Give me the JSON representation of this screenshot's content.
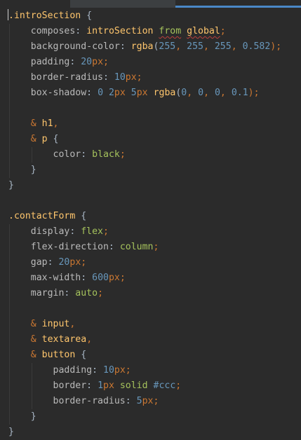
{
  "lines": [
    {
      "tokens": [
        {
          "t": ".",
          "c": "sel"
        },
        {
          "t": "introSection",
          "c": "sel"
        },
        {
          "t": " {",
          "c": "brace"
        }
      ]
    },
    {
      "tokens": [
        {
          "t": "    ",
          "c": ""
        },
        {
          "t": "composes",
          "c": "prop"
        },
        {
          "t": ": ",
          "c": "brace"
        },
        {
          "t": "introSection",
          "c": "fn"
        },
        {
          "t": " ",
          "c": ""
        },
        {
          "t": "from",
          "c": "val squig"
        },
        {
          "t": " ",
          "c": ""
        },
        {
          "t": "global",
          "c": "fn squig"
        },
        {
          "t": ";",
          "c": "punct"
        }
      ]
    },
    {
      "tokens": [
        {
          "t": "    ",
          "c": ""
        },
        {
          "t": "background-color",
          "c": "prop"
        },
        {
          "t": ": ",
          "c": "brace"
        },
        {
          "t": "rgba",
          "c": "fn"
        },
        {
          "t": "(",
          "c": "brace"
        },
        {
          "t": "255",
          "c": "num"
        },
        {
          "t": ", ",
          "c": "punct"
        },
        {
          "t": "255",
          "c": "num"
        },
        {
          "t": ", ",
          "c": "punct"
        },
        {
          "t": "255",
          "c": "num"
        },
        {
          "t": ", ",
          "c": "punct"
        },
        {
          "t": "0.582",
          "c": "num"
        },
        {
          "t": ");",
          "c": "punct"
        }
      ]
    },
    {
      "tokens": [
        {
          "t": "    ",
          "c": ""
        },
        {
          "t": "padding",
          "c": "prop"
        },
        {
          "t": ": ",
          "c": "brace"
        },
        {
          "t": "20",
          "c": "num"
        },
        {
          "t": "px",
          "c": "kw"
        },
        {
          "t": ";",
          "c": "punct"
        }
      ]
    },
    {
      "tokens": [
        {
          "t": "    ",
          "c": ""
        },
        {
          "t": "border-radius",
          "c": "prop"
        },
        {
          "t": ": ",
          "c": "brace"
        },
        {
          "t": "10",
          "c": "num"
        },
        {
          "t": "px",
          "c": "kw"
        },
        {
          "t": ";",
          "c": "punct"
        }
      ]
    },
    {
      "tokens": [
        {
          "t": "    ",
          "c": ""
        },
        {
          "t": "box-shadow",
          "c": "prop"
        },
        {
          "t": ": ",
          "c": "brace"
        },
        {
          "t": "0",
          "c": "num"
        },
        {
          "t": " ",
          "c": ""
        },
        {
          "t": "2",
          "c": "num"
        },
        {
          "t": "px",
          "c": "kw"
        },
        {
          "t": " ",
          "c": ""
        },
        {
          "t": "5",
          "c": "num"
        },
        {
          "t": "px",
          "c": "kw"
        },
        {
          "t": " ",
          "c": ""
        },
        {
          "t": "rgba",
          "c": "fn"
        },
        {
          "t": "(",
          "c": "brace"
        },
        {
          "t": "0",
          "c": "num"
        },
        {
          "t": ", ",
          "c": "punct"
        },
        {
          "t": "0",
          "c": "num"
        },
        {
          "t": ", ",
          "c": "punct"
        },
        {
          "t": "0",
          "c": "num"
        },
        {
          "t": ", ",
          "c": "punct"
        },
        {
          "t": "0.1",
          "c": "num"
        },
        {
          "t": ");",
          "c": "punct"
        }
      ]
    },
    {
      "tokens": []
    },
    {
      "tokens": [
        {
          "t": "    ",
          "c": ""
        },
        {
          "t": "& ",
          "c": "kw"
        },
        {
          "t": "h1",
          "c": "sel"
        },
        {
          "t": ",",
          "c": "punct"
        }
      ]
    },
    {
      "tokens": [
        {
          "t": "    ",
          "c": ""
        },
        {
          "t": "& ",
          "c": "kw"
        },
        {
          "t": "p",
          "c": "sel"
        },
        {
          "t": " {",
          "c": "brace"
        }
      ]
    },
    {
      "tokens": [
        {
          "t": "        ",
          "c": ""
        },
        {
          "t": "color",
          "c": "prop"
        },
        {
          "t": ": ",
          "c": "brace"
        },
        {
          "t": "black",
          "c": "val"
        },
        {
          "t": ";",
          "c": "punct"
        }
      ]
    },
    {
      "tokens": [
        {
          "t": "    ",
          "c": ""
        },
        {
          "t": "}",
          "c": "brace"
        }
      ]
    },
    {
      "tokens": [
        {
          "t": "}",
          "c": "brace"
        }
      ]
    },
    {
      "tokens": []
    },
    {
      "tokens": [
        {
          "t": ".",
          "c": "sel"
        },
        {
          "t": "contactForm",
          "c": "sel"
        },
        {
          "t": " {",
          "c": "brace"
        }
      ]
    },
    {
      "tokens": [
        {
          "t": "    ",
          "c": ""
        },
        {
          "t": "display",
          "c": "prop"
        },
        {
          "t": ": ",
          "c": "brace"
        },
        {
          "t": "flex",
          "c": "val"
        },
        {
          "t": ";",
          "c": "punct"
        }
      ]
    },
    {
      "tokens": [
        {
          "t": "    ",
          "c": ""
        },
        {
          "t": "flex-direction",
          "c": "prop"
        },
        {
          "t": ": ",
          "c": "brace"
        },
        {
          "t": "column",
          "c": "val"
        },
        {
          "t": ";",
          "c": "punct"
        }
      ]
    },
    {
      "tokens": [
        {
          "t": "    ",
          "c": ""
        },
        {
          "t": "gap",
          "c": "prop"
        },
        {
          "t": ": ",
          "c": "brace"
        },
        {
          "t": "20",
          "c": "num"
        },
        {
          "t": "px",
          "c": "kw"
        },
        {
          "t": ";",
          "c": "punct"
        }
      ]
    },
    {
      "tokens": [
        {
          "t": "    ",
          "c": ""
        },
        {
          "t": "max-width",
          "c": "prop"
        },
        {
          "t": ": ",
          "c": "brace"
        },
        {
          "t": "600",
          "c": "num"
        },
        {
          "t": "px",
          "c": "kw"
        },
        {
          "t": ";",
          "c": "punct"
        }
      ]
    },
    {
      "tokens": [
        {
          "t": "    ",
          "c": ""
        },
        {
          "t": "margin",
          "c": "prop"
        },
        {
          "t": ": ",
          "c": "brace"
        },
        {
          "t": "auto",
          "c": "val"
        },
        {
          "t": ";",
          "c": "punct"
        }
      ]
    },
    {
      "tokens": []
    },
    {
      "tokens": [
        {
          "t": "    ",
          "c": ""
        },
        {
          "t": "& ",
          "c": "kw"
        },
        {
          "t": "input",
          "c": "sel"
        },
        {
          "t": ",",
          "c": "punct"
        }
      ]
    },
    {
      "tokens": [
        {
          "t": "    ",
          "c": ""
        },
        {
          "t": "& ",
          "c": "kw"
        },
        {
          "t": "textarea",
          "c": "sel"
        },
        {
          "t": ",",
          "c": "punct"
        }
      ]
    },
    {
      "tokens": [
        {
          "t": "    ",
          "c": ""
        },
        {
          "t": "& ",
          "c": "kw"
        },
        {
          "t": "button",
          "c": "sel"
        },
        {
          "t": " {",
          "c": "brace"
        }
      ]
    },
    {
      "tokens": [
        {
          "t": "        ",
          "c": ""
        },
        {
          "t": "padding",
          "c": "prop"
        },
        {
          "t": ": ",
          "c": "brace"
        },
        {
          "t": "10",
          "c": "num"
        },
        {
          "t": "px",
          "c": "kw"
        },
        {
          "t": ";",
          "c": "punct"
        }
      ]
    },
    {
      "tokens": [
        {
          "t": "        ",
          "c": ""
        },
        {
          "t": "border",
          "c": "prop"
        },
        {
          "t": ": ",
          "c": "brace"
        },
        {
          "t": "1",
          "c": "num"
        },
        {
          "t": "px",
          "c": "kw"
        },
        {
          "t": " ",
          "c": ""
        },
        {
          "t": "solid",
          "c": "val"
        },
        {
          "t": " ",
          "c": ""
        },
        {
          "t": "#ccc",
          "c": "hash"
        },
        {
          "t": ";",
          "c": "punct"
        }
      ]
    },
    {
      "tokens": [
        {
          "t": "        ",
          "c": ""
        },
        {
          "t": "border-radius",
          "c": "prop"
        },
        {
          "t": ": ",
          "c": "brace"
        },
        {
          "t": "5",
          "c": "num"
        },
        {
          "t": "px",
          "c": "kw"
        },
        {
          "t": ";",
          "c": "punct"
        }
      ]
    },
    {
      "tokens": [
        {
          "t": "    ",
          "c": ""
        },
        {
          "t": "}",
          "c": "brace"
        }
      ]
    },
    {
      "tokens": [
        {
          "t": "}",
          "c": "brace"
        }
      ]
    }
  ]
}
